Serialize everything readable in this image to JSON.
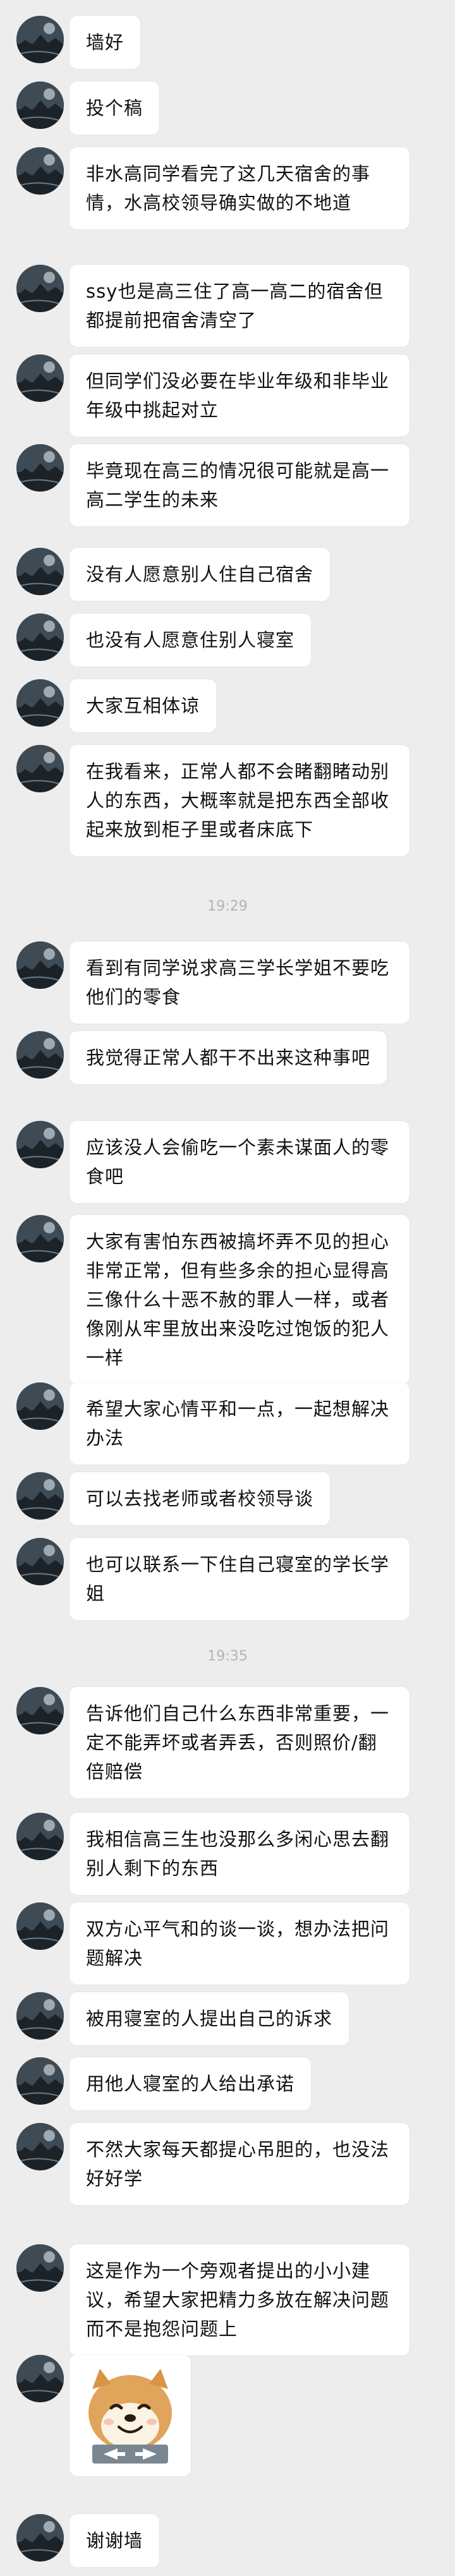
{
  "messages": [
    {
      "text": "墙好"
    },
    {
      "text": "投个稿"
    },
    {
      "text": "非水高同学看完了这几天宿舍的事情，水高校领导确实做的不地道"
    },
    {
      "text": "ssy也是高三住了高一高二的宿舍但都提前把宿舍清空了"
    },
    {
      "text": "但同学们没必要在毕业年级和非毕业年级中挑起对立"
    },
    {
      "text": "毕竟现在高三的情况很可能就是高一高二学生的未来"
    },
    {
      "text": "没有人愿意别人住自己宿舍"
    },
    {
      "text": "也没有人愿意住别人寝室"
    },
    {
      "text": "大家互相体谅"
    },
    {
      "text": "在我看来，正常人都不会睹翻睹动别人的东西，大概率就是把东西全部收起来放到柜子里或者床底下"
    },
    {
      "time": "19:29"
    },
    {
      "text": "看到有同学说求高三学长学姐不要吃他们的零食"
    },
    {
      "text": "我觉得正常人都干不出来这种事吧"
    },
    {
      "text": "应该没人会偷吃一个素未谋面人的零食吧"
    },
    {
      "text": "大家有害怕东西被搞坏弄不见的担心非常正常，但有些多余的担心显得高三像什么十恶不赦的罪人一样，或者像刚从牢里放出来没吃过饱饭的犯人一样"
    },
    {
      "text": "希望大家心情平和一点，一起想解决办法"
    },
    {
      "text": "可以去找老师或者校领导谈"
    },
    {
      "text": "也可以联系一下住自己寝室的学长学姐"
    },
    {
      "time": "19:35"
    },
    {
      "text": "告诉他们自己什么东西非常重要，一定不能弄坏或者弄丢，否则照价/翻倍赔偿"
    },
    {
      "text": "我相信高三生也没那么多闲心思去翻别人剩下的东西"
    },
    {
      "text": "双方心平气和的谈一谈，想办法把问题解决"
    },
    {
      "text": "被用寝室的人提出自己的诉求"
    },
    {
      "text": "用他人寝室的人给出承诺"
    },
    {
      "text": "不然大家每天都提心吊胆的，也没法好好学"
    },
    {
      "text": "这是作为一个旁观者提出的小小建议，希望大家把精力多放在解决问题而不是抱怨问题上"
    },
    {
      "sticker": "shiba-dog-thumbs-sticker"
    },
    {
      "text": "谢谢墙"
    }
  ]
}
